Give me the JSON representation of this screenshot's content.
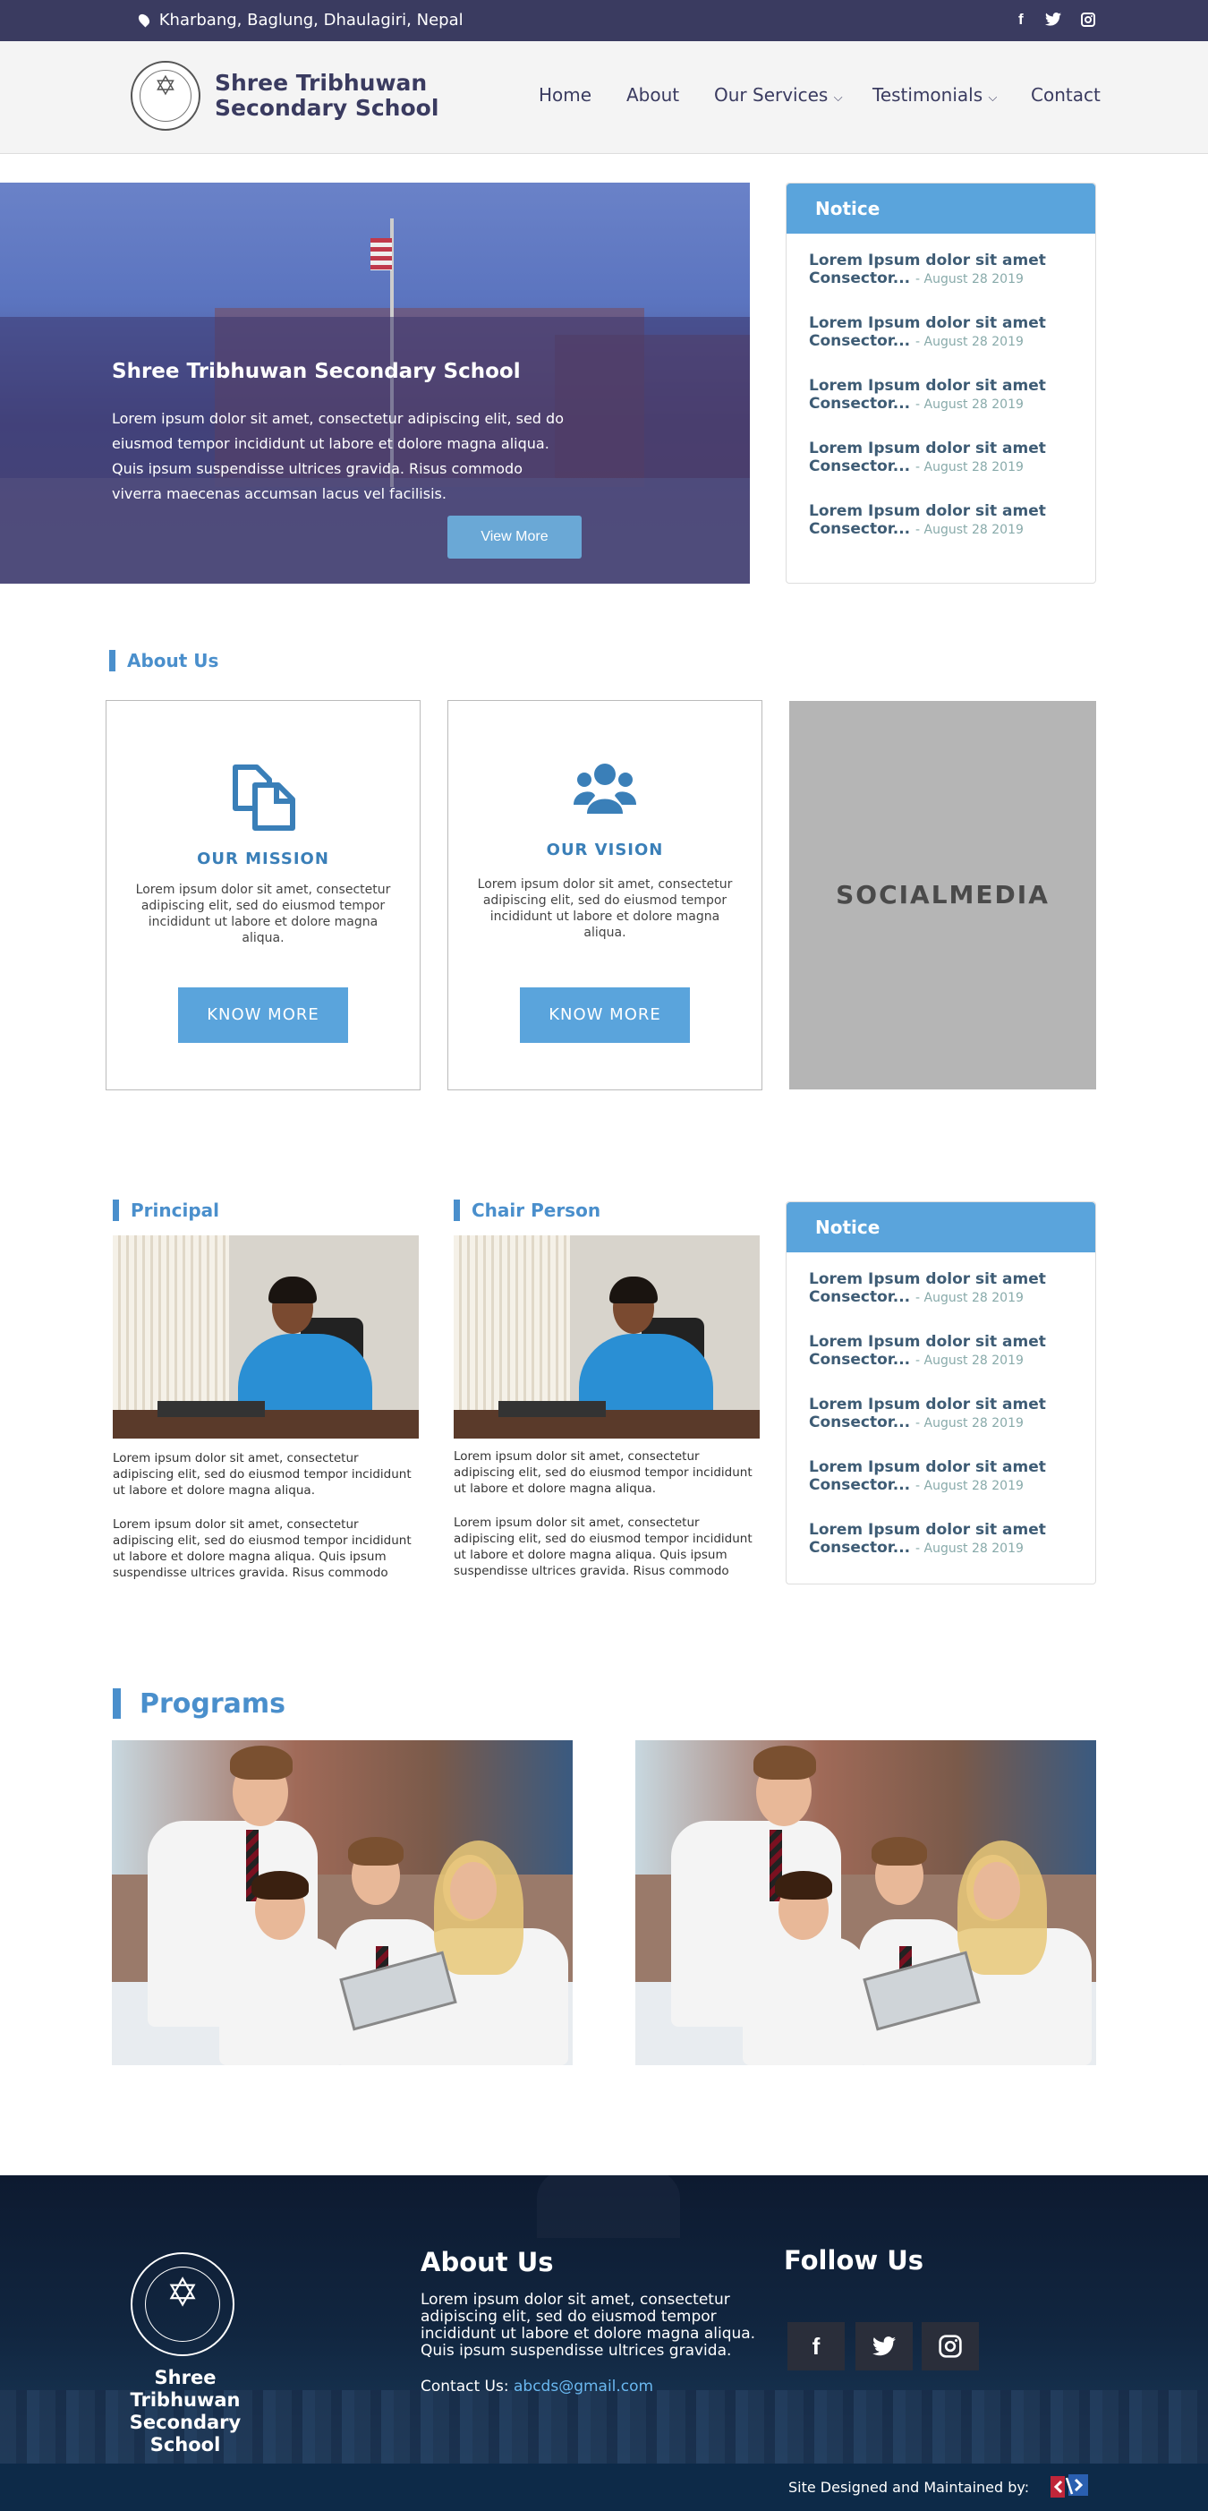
{
  "topbar": {
    "address": "Kharbang, Baglung, Dhaulagiri, Nepal",
    "social": {
      "facebook": "f",
      "twitter": "twitter-icon",
      "instagram": "instagram-icon"
    }
  },
  "header": {
    "school_name_line1": "Shree Tribhuwan",
    "school_name_line2": "Secondary School",
    "nav": [
      {
        "label": "Home"
      },
      {
        "label": "About"
      },
      {
        "label": "Our Services"
      },
      {
        "label": "Testimonials"
      },
      {
        "label": "Contact"
      }
    ]
  },
  "hero": {
    "title": "Shree Tribhuwan Secondary School",
    "text": "Lorem ipsum dolor sit amet, consectetur adipiscing elit, sed do eiusmod tempor incididunt ut labore et dolore magna aliqua. Quis ipsum suspendisse ultrices gravida. Risus commodo viverra maecenas accumsan lacus vel facilisis.",
    "button": "View More"
  },
  "notice_top": {
    "heading": "Notice",
    "items": [
      {
        "title": "Lorem Ipsum dolor sit amet Consector...",
        "date": "- August 28 2019"
      },
      {
        "title": "Lorem Ipsum dolor sit amet Consector...",
        "date": "- August 28 2019"
      },
      {
        "title": "Lorem Ipsum dolor sit amet Consector...",
        "date": "- August 28 2019"
      },
      {
        "title": "Lorem Ipsum dolor sit amet Consector...",
        "date": "- August 28 2019"
      },
      {
        "title": "Lorem Ipsum dolor sit amet Consector...",
        "date": "- August 28 2019"
      }
    ]
  },
  "about": {
    "heading": "About Us",
    "mission": {
      "title": "OUR MISSION",
      "text": "Lorem ipsum dolor sit amet, consectetur adipiscing elit, sed do eiusmod tempor incididunt ut labore et dolore magna aliqua.",
      "button": "KNOW MORE"
    },
    "vision": {
      "title": "OUR VISION",
      "text": "Lorem ipsum dolor sit amet, consectetur adipiscing elit, sed do eiusmod tempor incididunt ut labore et dolore magna aliqua.",
      "button": "KNOW MORE"
    },
    "social_placeholder": "SOCIALMEDIA"
  },
  "principal": {
    "heading": "Principal",
    "para1": "Lorem ipsum dolor sit amet, consectetur adipiscing elit, sed do eiusmod tempor incididunt ut labore et dolore magna aliqua.",
    "para2": "Lorem ipsum dolor sit amet, consectetur adipiscing elit, sed do eiusmod tempor incididunt ut labore et dolore magna aliqua. Quis ipsum suspendisse ultrices gravida. Risus commodo viverra maecenas"
  },
  "chair": {
    "heading": "Chair Person",
    "para1": "Lorem ipsum dolor sit amet, consectetur adipiscing elit, sed do eiusmod tempor incididunt ut labore et dolore magna aliqua.",
    "para2": "Lorem ipsum dolor sit amet, consectetur adipiscing elit, sed do eiusmod tempor incididunt ut labore et dolore magna aliqua. Quis ipsum suspendisse ultrices gravida. Risus commodo viverra maecenas"
  },
  "notice_mid": {
    "heading": "Notice",
    "items": [
      {
        "title": "Lorem Ipsum dolor sit amet Consector...",
        "date": "- August 28 2019"
      },
      {
        "title": "Lorem Ipsum dolor sit amet Consector...",
        "date": "- August 28 2019"
      },
      {
        "title": "Lorem Ipsum dolor sit amet Consector...",
        "date": "- August 28 2019"
      },
      {
        "title": "Lorem Ipsum dolor sit amet Consector...",
        "date": "- August 28 2019"
      },
      {
        "title": "Lorem Ipsum dolor sit amet Consector...",
        "date": "- August 28 2019"
      }
    ]
  },
  "programs": {
    "heading": "Programs"
  },
  "footer": {
    "school_name_line1": "Shree Tribhuwan",
    "school_name_line2": "Secondary School",
    "about_heading": "About Us",
    "about_text": "Lorem ipsum dolor sit amet, consectetur adipiscing elit, sed do eiusmod tempor incididunt ut labore et dolore magna aliqua. Quis ipsum suspendisse ultrices gravida.",
    "contact_label": "Contact Us:",
    "contact_email": "abcds@gmail.com",
    "follow_heading": "Follow Us",
    "credit": "Site Designed and Maintained by:"
  },
  "colors": {
    "topbar": "#3a3b60",
    "accent": "#5aa4dc",
    "heading_blue": "#4a8fcc",
    "footer_bg": "#0d1a30"
  }
}
